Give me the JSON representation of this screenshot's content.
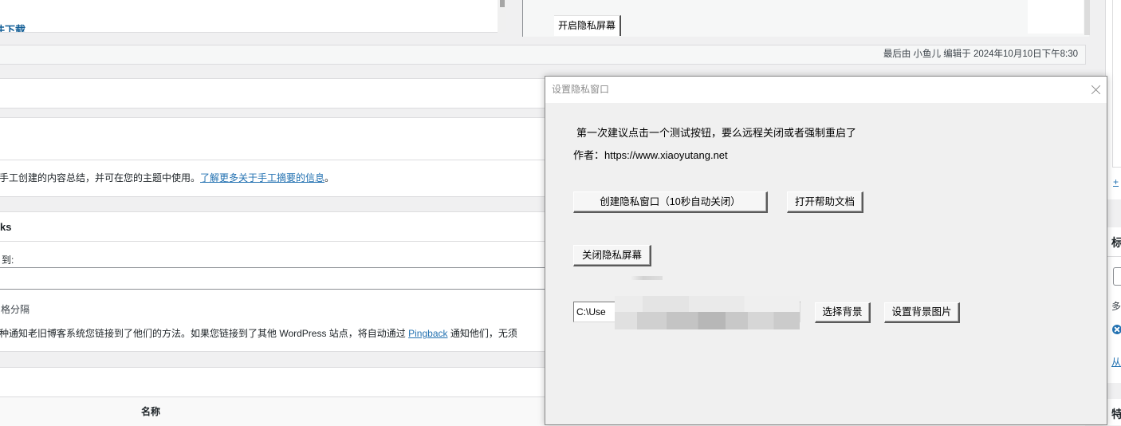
{
  "top_panel": {
    "download_link": "件下载",
    "privacy_on_button": "开启隐私屏幕"
  },
  "meta_bar": {
    "last_edited": "最后由 小鱼儿 编辑于 2024年10月10日下午8:30"
  },
  "excerpt": {
    "description": "手工创建的内容总结，并可在您的主题中使用。",
    "learn_more_link": "了解更多关于手工摘要的信息",
    "end_punct": "。"
  },
  "trackbacks": {
    "title": "ks",
    "send_to_label": "到:",
    "hint": "格分隔",
    "description": "种通知老旧博客系统您链接到了他们的方法。如果您链接到了其他 WordPress 站点，将自动通过 ",
    "pingback_link": "Pingback",
    "description_end": " 通知他们，无须"
  },
  "custom_fields": {
    "name_header": "名称"
  },
  "right_sidebar": {
    "add_link": "+",
    "tags_header": "标",
    "tags_hint": "多",
    "remove_tag_icon": "circle-x-icon",
    "choose_from_link": "从",
    "featured_header": "特"
  },
  "dialog": {
    "title": "设置隐私窗口",
    "close_icon": "close-icon",
    "tip": "第一次建议点击一个测试按钮，要么远程关闭或者强制重启了",
    "author": "作者：https://www.xiaoyutang.net",
    "create_button": "创建隐私窗口（10秒自动关闭）",
    "help_button": "打开帮助文档",
    "close_screen_button": "关闭隐私屏幕",
    "bg_path_value": "C:\\Use",
    "choose_bg_button": "选择背景",
    "set_bg_button": "设置背景图片"
  },
  "colors": {
    "link": "#2271b1",
    "dialog_bg": "#f0f0f0"
  }
}
